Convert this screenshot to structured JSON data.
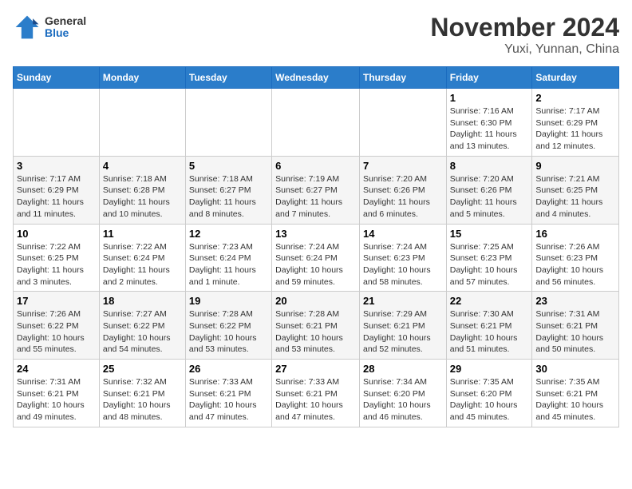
{
  "header": {
    "logo": {
      "general": "General",
      "blue": "Blue"
    },
    "title": "November 2024",
    "location": "Yuxi, Yunnan, China"
  },
  "calendar": {
    "days_of_week": [
      "Sunday",
      "Monday",
      "Tuesday",
      "Wednesday",
      "Thursday",
      "Friday",
      "Saturday"
    ],
    "weeks": [
      [
        {
          "day": "",
          "info": ""
        },
        {
          "day": "",
          "info": ""
        },
        {
          "day": "",
          "info": ""
        },
        {
          "day": "",
          "info": ""
        },
        {
          "day": "",
          "info": ""
        },
        {
          "day": "1",
          "info": "Sunrise: 7:16 AM\nSunset: 6:30 PM\nDaylight: 11 hours and 13 minutes."
        },
        {
          "day": "2",
          "info": "Sunrise: 7:17 AM\nSunset: 6:29 PM\nDaylight: 11 hours and 12 minutes."
        }
      ],
      [
        {
          "day": "3",
          "info": "Sunrise: 7:17 AM\nSunset: 6:29 PM\nDaylight: 11 hours and 11 minutes."
        },
        {
          "day": "4",
          "info": "Sunrise: 7:18 AM\nSunset: 6:28 PM\nDaylight: 11 hours and 10 minutes."
        },
        {
          "day": "5",
          "info": "Sunrise: 7:18 AM\nSunset: 6:27 PM\nDaylight: 11 hours and 8 minutes."
        },
        {
          "day": "6",
          "info": "Sunrise: 7:19 AM\nSunset: 6:27 PM\nDaylight: 11 hours and 7 minutes."
        },
        {
          "day": "7",
          "info": "Sunrise: 7:20 AM\nSunset: 6:26 PM\nDaylight: 11 hours and 6 minutes."
        },
        {
          "day": "8",
          "info": "Sunrise: 7:20 AM\nSunset: 6:26 PM\nDaylight: 11 hours and 5 minutes."
        },
        {
          "day": "9",
          "info": "Sunrise: 7:21 AM\nSunset: 6:25 PM\nDaylight: 11 hours and 4 minutes."
        }
      ],
      [
        {
          "day": "10",
          "info": "Sunrise: 7:22 AM\nSunset: 6:25 PM\nDaylight: 11 hours and 3 minutes."
        },
        {
          "day": "11",
          "info": "Sunrise: 7:22 AM\nSunset: 6:24 PM\nDaylight: 11 hours and 2 minutes."
        },
        {
          "day": "12",
          "info": "Sunrise: 7:23 AM\nSunset: 6:24 PM\nDaylight: 11 hours and 1 minute."
        },
        {
          "day": "13",
          "info": "Sunrise: 7:24 AM\nSunset: 6:24 PM\nDaylight: 10 hours and 59 minutes."
        },
        {
          "day": "14",
          "info": "Sunrise: 7:24 AM\nSunset: 6:23 PM\nDaylight: 10 hours and 58 minutes."
        },
        {
          "day": "15",
          "info": "Sunrise: 7:25 AM\nSunset: 6:23 PM\nDaylight: 10 hours and 57 minutes."
        },
        {
          "day": "16",
          "info": "Sunrise: 7:26 AM\nSunset: 6:23 PM\nDaylight: 10 hours and 56 minutes."
        }
      ],
      [
        {
          "day": "17",
          "info": "Sunrise: 7:26 AM\nSunset: 6:22 PM\nDaylight: 10 hours and 55 minutes."
        },
        {
          "day": "18",
          "info": "Sunrise: 7:27 AM\nSunset: 6:22 PM\nDaylight: 10 hours and 54 minutes."
        },
        {
          "day": "19",
          "info": "Sunrise: 7:28 AM\nSunset: 6:22 PM\nDaylight: 10 hours and 53 minutes."
        },
        {
          "day": "20",
          "info": "Sunrise: 7:28 AM\nSunset: 6:21 PM\nDaylight: 10 hours and 53 minutes."
        },
        {
          "day": "21",
          "info": "Sunrise: 7:29 AM\nSunset: 6:21 PM\nDaylight: 10 hours and 52 minutes."
        },
        {
          "day": "22",
          "info": "Sunrise: 7:30 AM\nSunset: 6:21 PM\nDaylight: 10 hours and 51 minutes."
        },
        {
          "day": "23",
          "info": "Sunrise: 7:31 AM\nSunset: 6:21 PM\nDaylight: 10 hours and 50 minutes."
        }
      ],
      [
        {
          "day": "24",
          "info": "Sunrise: 7:31 AM\nSunset: 6:21 PM\nDaylight: 10 hours and 49 minutes."
        },
        {
          "day": "25",
          "info": "Sunrise: 7:32 AM\nSunset: 6:21 PM\nDaylight: 10 hours and 48 minutes."
        },
        {
          "day": "26",
          "info": "Sunrise: 7:33 AM\nSunset: 6:21 PM\nDaylight: 10 hours and 47 minutes."
        },
        {
          "day": "27",
          "info": "Sunrise: 7:33 AM\nSunset: 6:21 PM\nDaylight: 10 hours and 47 minutes."
        },
        {
          "day": "28",
          "info": "Sunrise: 7:34 AM\nSunset: 6:20 PM\nDaylight: 10 hours and 46 minutes."
        },
        {
          "day": "29",
          "info": "Sunrise: 7:35 AM\nSunset: 6:20 PM\nDaylight: 10 hours and 45 minutes."
        },
        {
          "day": "30",
          "info": "Sunrise: 7:35 AM\nSunset: 6:21 PM\nDaylight: 10 hours and 45 minutes."
        }
      ]
    ]
  }
}
